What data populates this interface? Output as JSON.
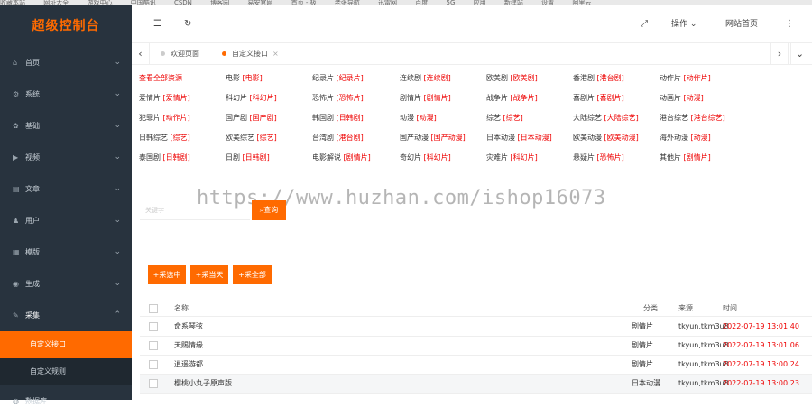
{
  "bookmarks": [
    "收藏本站",
    "网址大全",
    "游戏中心",
    "中国酷讯",
    "CSDN",
    "博客园",
    "易安官网",
    "首页 - 极",
    "老张导航",
    "迅雷网",
    "百度",
    "5G",
    "应用",
    "新建站",
    "设置",
    "阿里云"
  ],
  "sidebar": {
    "title": "超级控制台",
    "items": [
      {
        "label": "首页",
        "icon": "⌂"
      },
      {
        "label": "系统",
        "icon": "⚙"
      },
      {
        "label": "基础",
        "icon": "✿"
      },
      {
        "label": "视频",
        "icon": "▶"
      },
      {
        "label": "文章",
        "icon": "▤"
      },
      {
        "label": "用户",
        "icon": "♟"
      },
      {
        "label": "模版",
        "icon": "▦"
      },
      {
        "label": "生成",
        "icon": "◉"
      },
      {
        "label": "采集",
        "icon": "✎"
      }
    ],
    "subitems": [
      {
        "label": "自定义接口"
      },
      {
        "label": "自定义规则"
      }
    ],
    "next_item": {
      "label": "数据库"
    }
  },
  "header": {
    "menu_icon": "☰",
    "refresh_icon": "↻",
    "fullscreen_icon": "⤢",
    "operate_label": "操作",
    "site_home_label": "网站首页",
    "more_icon": "⋮"
  },
  "tabs": {
    "items": [
      {
        "label": "欢迎页面"
      },
      {
        "label": "自定义接口"
      }
    ]
  },
  "categories": [
    [
      {
        "n": "查看全部资源",
        "all": true
      },
      {
        "n": "电影",
        "t": "[电影]"
      },
      {
        "n": "纪录片",
        "t": "[纪录片]"
      },
      {
        "n": "连续剧",
        "t": "[连续剧]"
      },
      {
        "n": "欧美剧",
        "t": "[欧美剧]"
      },
      {
        "n": "香港剧",
        "t": "[港台剧]"
      },
      {
        "n": "动作片",
        "t": "[动作片]"
      }
    ],
    [
      {
        "n": "爱情片",
        "t": "[爱情片]"
      },
      {
        "n": "科幻片",
        "t": "[科幻片]"
      },
      {
        "n": "恐怖片",
        "t": "[恐怖片]"
      },
      {
        "n": "剧情片",
        "t": "[剧情片]"
      },
      {
        "n": "战争片",
        "t": "[战争片]"
      },
      {
        "n": "喜剧片",
        "t": "[喜剧片]"
      },
      {
        "n": "动画片",
        "t": "[动漫]"
      }
    ],
    [
      {
        "n": "犯罪片",
        "t": "[动作片]"
      },
      {
        "n": "国产剧",
        "t": "[国产剧]"
      },
      {
        "n": "韩国剧",
        "t": "[日韩剧]"
      },
      {
        "n": "动漫",
        "t": "[动漫]"
      },
      {
        "n": "综艺",
        "t": "[综艺]"
      },
      {
        "n": "大陆综艺",
        "t": "[大陆综艺]"
      },
      {
        "n": "港台综艺",
        "t": "[港台综艺]"
      }
    ],
    [
      {
        "n": "日韩综艺",
        "t": "[综艺]"
      },
      {
        "n": "欧美综艺",
        "t": "[综艺]"
      },
      {
        "n": "台湾剧",
        "t": "[港台剧]"
      },
      {
        "n": "国产动漫",
        "t": "[国产动漫]"
      },
      {
        "n": "日本动漫",
        "t": "[日本动漫]"
      },
      {
        "n": "欧美动漫",
        "t": "[欧美动漫]"
      },
      {
        "n": "海外动漫",
        "t": "[动漫]"
      }
    ],
    [
      {
        "n": "泰国剧",
        "t": "[日韩剧]"
      },
      {
        "n": "日剧",
        "t": "[日韩剧]"
      },
      {
        "n": "电影解说",
        "t": "[剧情片]"
      },
      {
        "n": "奇幻片",
        "t": "[科幻片]"
      },
      {
        "n": "灾难片",
        "t": "[科幻片]"
      },
      {
        "n": "悬疑片",
        "t": "[恐怖片]"
      },
      {
        "n": "其他片",
        "t": "[剧情片]"
      }
    ]
  ],
  "search": {
    "placeholder": "关键字",
    "button_label": "查询"
  },
  "watermark": "https://www.huzhan.com/ishop16073",
  "actions": {
    "collect_selected": "+采选中",
    "collect_today": "+采当天",
    "collect_all": "+采全部"
  },
  "table": {
    "headers": {
      "name": "名称",
      "category": "分类",
      "source": "来源",
      "time": "时间"
    },
    "rows": [
      {
        "name": "命系琴弦",
        "category": "剧情片",
        "source": "tkyun,tkm3u8",
        "time": "2022-07-19 13:01:40"
      },
      {
        "name": "天赐情缘",
        "category": "剧情片",
        "source": "tkyun,tkm3u8",
        "time": "2022-07-19 13:01:06"
      },
      {
        "name": "逍遥游都",
        "category": "剧情片",
        "source": "tkyun,tkm3u8",
        "time": "2022-07-19 13:00:24"
      },
      {
        "name": "樱桃小丸子原声版",
        "category": "日本动漫",
        "source": "tkyun,tkm3u8",
        "time": "2022-07-19 13:00:23"
      }
    ]
  },
  "colors": {
    "accent": "#ff6a00",
    "sidebar_bg": "#28333e",
    "link_red": "#e00000"
  }
}
